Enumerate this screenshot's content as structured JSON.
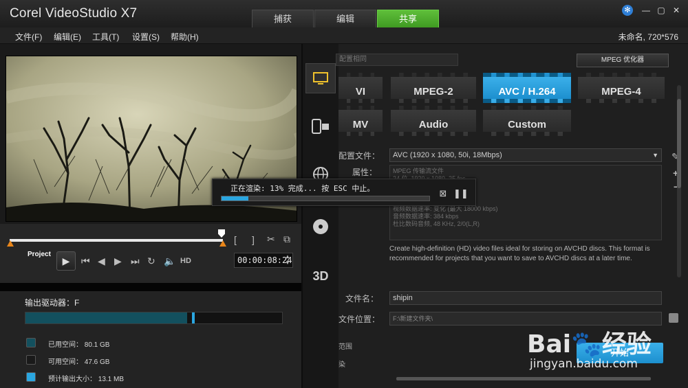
{
  "app": {
    "title": "Corel VideoStudio X7",
    "tabs": [
      "捕获",
      "编辑",
      "共享"
    ],
    "active_tab": "共享",
    "project_info": "未命名, 720*576"
  },
  "menu": [
    "文件(F)",
    "编辑(E)",
    "工具(T)",
    "设置(S)",
    "帮助(H)"
  ],
  "player": {
    "project_label": "Project",
    "hd_label": "HD",
    "timecode": "00:00:08:24",
    "spin_up": "▲",
    "spin_down": "▼",
    "icons": {
      "mark_in": "[",
      "mark_out": "]",
      "cut": "✂",
      "copy": "⧉",
      "play": "▶",
      "home": "⏮",
      "prev": "◀",
      "next": "▶",
      "end": "⏭",
      "repeat": "↻",
      "volume": "🔈"
    },
    "scrub_position": 0.99
  },
  "output": {
    "drive_label": "输出驱动器：F",
    "used_fraction": 0.63,
    "estimate_fraction": 0.65,
    "legend": [
      {
        "label": "已用空间：  80.1 GB",
        "color": "#13505e"
      },
      {
        "label": "可用空间：  47.6 GB",
        "color": "#1a1a1a"
      },
      {
        "label": "预计输出大小：  13.1 MB",
        "color": "#2aa6e0"
      }
    ]
  },
  "share": {
    "profile_top": "配置相同",
    "mpeg_optimizer": "MPEG 优化器",
    "formats": [
      "AVI",
      "MPEG-2",
      "AVC / H.264",
      "MPEG-4",
      "WMV",
      "Audio",
      "Custom"
    ],
    "visible_formats": [
      "VI",
      "MPEG-2",
      "AVC / H.264",
      "MPEG-4",
      "MV",
      "Audio",
      "Custom"
    ],
    "selected_format": "AVC / H.264",
    "profile_label": "配置文件：",
    "profile_value": "AVC (1920 x 1080, 50i, 18Mbps)",
    "properties_label": "属性：",
    "properties": [
      "MPEG 传输流文件",
      "24 位, 1920 x 1080, 25 fps",
      "",
      "",
      "",
      "视频数据速率: 变化 (最大 18000 kbps)",
      "音频数据速率: 384 kbps",
      "杜比数码音频, 48 KHz, 2/0(L,R)"
    ],
    "description": "Create high-definition (HD) video files ideal for storing on AVCHD discs. This format is recommended for projects that you want to save to AVCHD discs at a later time.",
    "filename_label": "文件名：",
    "filename": "shipin",
    "location_label": "文件位置：",
    "location": "F:\\新建文件夹\\",
    "partial_1": "范围",
    "partial_2": "染",
    "start_label": "开始"
  },
  "sidebar_icons": [
    "computer-icon",
    "device-icon",
    "web-icon",
    "disc-icon",
    "3d-icon"
  ],
  "sidebar_3d_text": "3D",
  "render": {
    "status": "正在渲染: 13% 完成... 按 ESC 中止。",
    "progress": 0.13
  },
  "watermark": {
    "brand": "Bai🐾经验",
    "url": "jingyan.baidu.com"
  }
}
